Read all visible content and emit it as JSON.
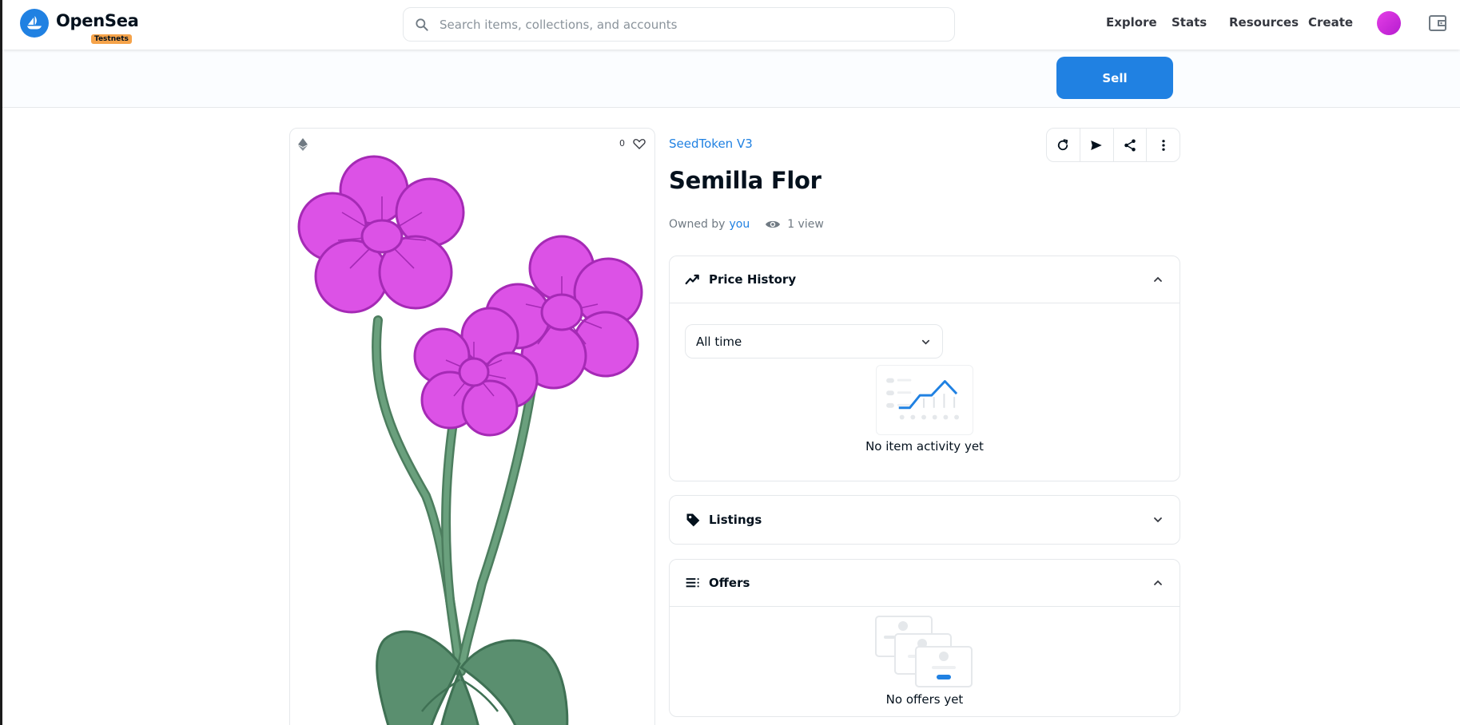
{
  "header": {
    "brand": "OpenSea",
    "badge": "Testnets",
    "search_placeholder": "Search items, collections, and accounts",
    "nav": [
      "Explore",
      "Stats",
      "Resources",
      "Create"
    ]
  },
  "actions": {
    "sell_label": "Sell"
  },
  "item": {
    "favorites": "0",
    "collection": "SeedToken V3",
    "name": "Semilla Flor",
    "owned_prefix": "Owned by",
    "owner": "you",
    "views": "1 view"
  },
  "price_history": {
    "title": "Price History",
    "range": "All time",
    "empty": "No item activity yet"
  },
  "listings": {
    "title": "Listings"
  },
  "offers": {
    "title": "Offers",
    "empty": "No offers yet"
  },
  "colors": {
    "accent": "#2081e2",
    "flower": "#dc52e6",
    "stem": "#5a8f6f",
    "badge": "#f5a34a"
  }
}
